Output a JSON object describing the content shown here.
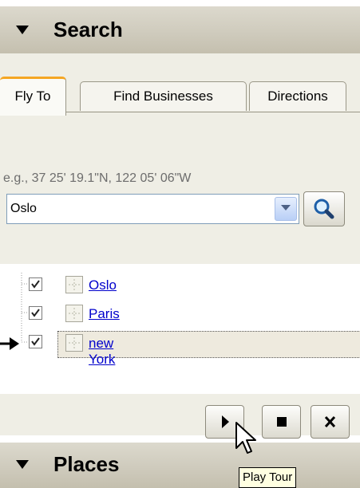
{
  "search_header": {
    "label": "Search"
  },
  "tabs": [
    {
      "label": "Fly To",
      "active": true
    },
    {
      "label": "Find Businesses",
      "active": false
    },
    {
      "label": "Directions",
      "active": false
    }
  ],
  "fly_to": {
    "hint": "e.g., 37 25' 19.1\"N, 122 05' 06\"W",
    "value": "Oslo"
  },
  "results": [
    {
      "label": "Oslo",
      "checked": true
    },
    {
      "label": "Paris",
      "checked": true
    },
    {
      "label": "new York",
      "checked": true,
      "selected": true
    }
  ],
  "places_header": {
    "label": "Places"
  },
  "tooltip": "Play Tour"
}
